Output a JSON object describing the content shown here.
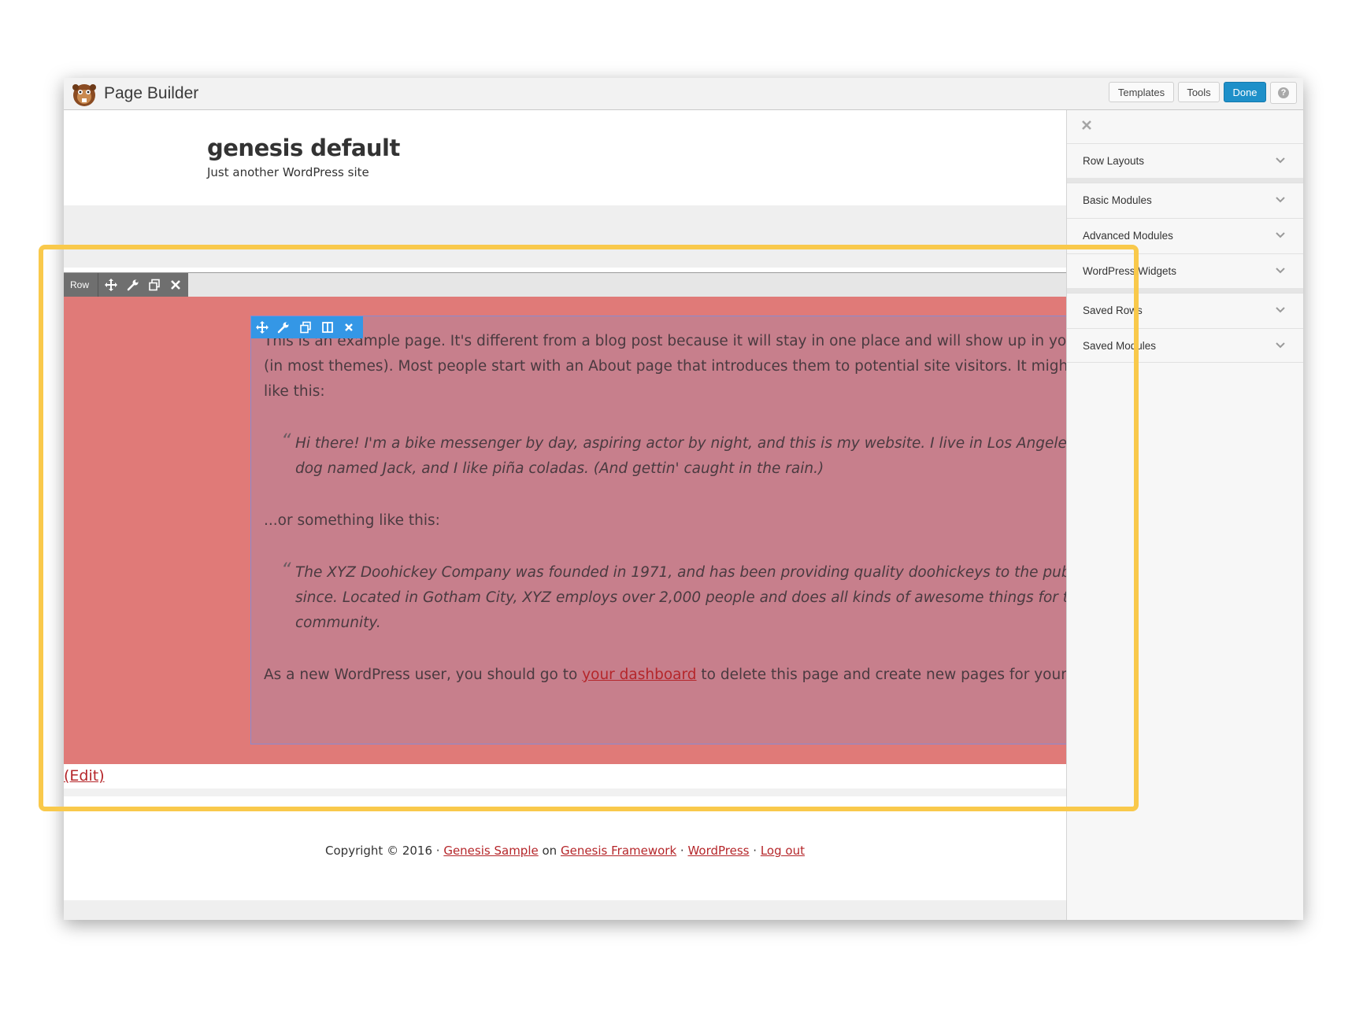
{
  "topbar": {
    "app_title": "Page Builder",
    "templates_label": "Templates",
    "tools_label": "Tools",
    "done_label": "Done",
    "help_glyph": "?"
  },
  "site": {
    "title": "genesis default",
    "tagline": "Just another WordPress site"
  },
  "row_toolbar": {
    "label": "Row"
  },
  "content": {
    "p1_line1": "This is an example page. It's different from a blog post because it will stay in one place and will show up in your site navigation",
    "p1_line2": "(in most themes). Most people start with an About page that introduces them to potential site visitors. It might say something",
    "p1_line3": "like this:",
    "q1_line1": "Hi there! I'm a bike messenger by day, aspiring actor by night, and this is my website. I live in Los Angeles, have a great",
    "q1_line2": "dog named Jack, and I like piña coladas. (And gettin' caught in the rain.)",
    "p2": "...or something like this:",
    "q2_line1": "The XYZ Doohickey Company was founded in 1971, and has been providing quality doohickeys to the public ever",
    "q2_line2": "since. Located in Gotham City, XYZ employs over 2,000 people and does all kinds of awesome things for the Gotham",
    "q2_line3": "community.",
    "p3_before": "As a new WordPress user, you should go to ",
    "p3_link": "your dashboard",
    "p3_after": " to delete this page and create new pages for your content. Have fun!",
    "quote_mark": "“"
  },
  "edit_link": "(Edit)",
  "footer": {
    "copyright": "Copyright © 2016 · ",
    "genesis_sample": "Genesis Sample",
    "on": " on ",
    "genesis_framework": "Genesis Framework",
    "sep1": " · ",
    "wordpress": "WordPress",
    "sep2": " · ",
    "logout": "Log out"
  },
  "panel": {
    "items": [
      {
        "label": "Row Layouts"
      },
      {
        "label": "Basic Modules"
      },
      {
        "label": "Advanced Modules"
      },
      {
        "label": "WordPress Widgets"
      },
      {
        "label": "Saved Rows"
      },
      {
        "label": "Saved Modules"
      }
    ]
  },
  "colors": {
    "accent_blue": "#1e90c9",
    "row_red": "#e07a78",
    "module_overlay": "#c77f8c",
    "link_red": "#b5262a",
    "highlight_yellow": "#f9c94b"
  },
  "icons": [
    "beaver-logo-icon",
    "help-icon",
    "move-icon",
    "wrench-icon",
    "duplicate-icon",
    "columns-icon",
    "close-icon",
    "chevron-down-icon"
  ]
}
